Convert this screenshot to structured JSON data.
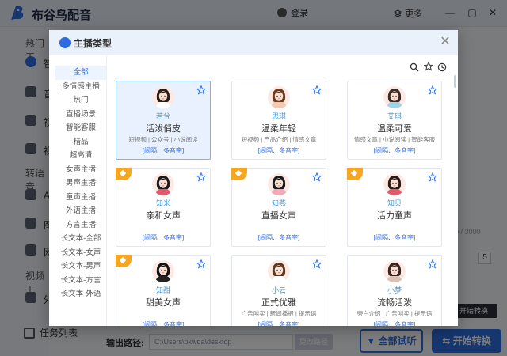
{
  "app": {
    "title": "布谷鸟配音",
    "login_label": "登录",
    "more_label": "更多",
    "sidebar": {
      "group1": "热门工",
      "items": [
        "智",
        "音",
        "视",
        "视"
      ],
      "group2": "转语音",
      "items2": [
        "A",
        "图",
        "网"
      ],
      "group3": "视频工",
      "items3": [
        "外"
      ],
      "task_list": "任务列表"
    },
    "output_label": "输出路径:",
    "output_path": "C:\\Users\\pkwoa\\desktop",
    "change_path": "更改路径",
    "try_all": "全部试听",
    "start_convert": "开始转换",
    "counter_text": "0 / 3000",
    "stepper_value": "5",
    "tooltip_text": "开始转换"
  },
  "dialog": {
    "title": "主播类型",
    "categories": [
      "全部",
      "多情感主播",
      "热门",
      "直播场景",
      "智能客服",
      "精品",
      "超高清",
      "女声主播",
      "男声主播",
      "童声主播",
      "外语主播",
      "方言主播",
      "长文本-全部",
      "长文本-女声",
      "长文本-男声",
      "长文本-方言",
      "长文本-外语"
    ],
    "active_category": "全部",
    "voices": [
      {
        "name": "若兮",
        "style": "活泼俏皮",
        "tags": "短视频 | 公众号 | 小说阅读",
        "links": "[间隔、多音字]",
        "vip": false,
        "selected": true,
        "hair": "#2b1d16",
        "shirt": "#ffffff"
      },
      {
        "name": "思琪",
        "style": "温柔年轻",
        "tags": "短视频 | 产品介绍 | 情感文章",
        "links": "[间隔、多音字]",
        "vip": false,
        "selected": false,
        "hair": "#6b3d22",
        "shirt": "#f4c7b0"
      },
      {
        "name": "艾琪",
        "style": "温柔可爱",
        "tags": "情感文章 | 小说阅读 | 智能客服",
        "links": "[间隔、多音字]",
        "vip": false,
        "selected": false,
        "hair": "#3a2a24",
        "shirt": "#9fd3e6"
      },
      {
        "name": "知米",
        "style": "亲和女声",
        "tags": "",
        "links": "[间隔、多音字]",
        "vip": true,
        "selected": false,
        "hair": "#1b1b1b",
        "shirt": "#e05a6a"
      },
      {
        "name": "知燕",
        "style": "直播女声",
        "tags": "",
        "links": "[间隔、多音字]",
        "vip": true,
        "selected": false,
        "hair": "#1b1b1b",
        "shirt": "#f4a9b8"
      },
      {
        "name": "知贝",
        "style": "活力童声",
        "tags": "",
        "links": "[间隔、多音字]",
        "vip": true,
        "selected": false,
        "hair": "#2a1a15",
        "shirt": "#e05a6a"
      },
      {
        "name": "知甜",
        "style": "甜美女声",
        "tags": "",
        "links": "[间隔、多音字]",
        "vip": true,
        "selected": false,
        "hair": "#111111",
        "shirt": "#222222"
      },
      {
        "name": "小云",
        "style": "正式优雅",
        "tags": "广告叫卖 | 新闻播报 | 提示语",
        "links": "[间隔、多音字]",
        "vip": false,
        "selected": false,
        "hair": "#5a3a22",
        "shirt": "#ffffff"
      },
      {
        "name": "小梦",
        "style": "流畅活泼",
        "tags": "旁白介绍 | 广告叫卖 | 提示语",
        "links": "[间隔、多音字]",
        "vip": false,
        "selected": false,
        "hair": "#3a2420",
        "shirt": "#d9c2b0"
      }
    ]
  },
  "colors": {
    "accent": "#2d6cdf",
    "vip": "#f5a623",
    "name_blue": "#4a9ad8"
  }
}
